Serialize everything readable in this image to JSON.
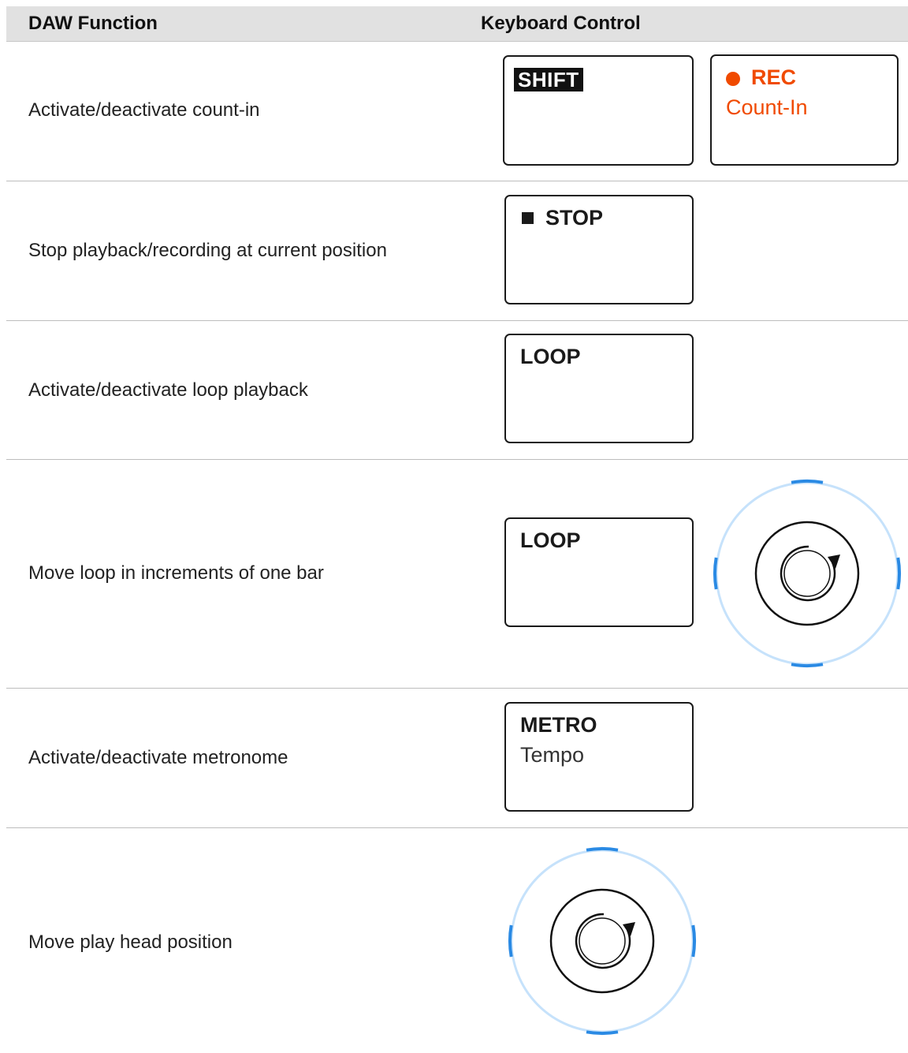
{
  "table": {
    "headers": {
      "function": "DAW Function",
      "control": "Keyboard Control"
    },
    "rows": [
      {
        "function": "Activate/deactivate count-in",
        "keys": [
          {
            "label": "SHIFT",
            "sub": ""
          },
          {
            "label": "REC",
            "sub": "Count-In",
            "indicator": "record-dot-icon"
          }
        ]
      },
      {
        "function": "Stop playback/recording at current position",
        "keys": [
          {
            "label": "STOP",
            "sub": "",
            "indicator": "stop-square-icon"
          }
        ]
      },
      {
        "function": "Activate/deactivate loop playback",
        "keys": [
          {
            "label": "LOOP",
            "sub": ""
          }
        ]
      },
      {
        "function": "Move loop in increments of one bar",
        "keys": [
          {
            "label": "LOOP",
            "sub": ""
          }
        ],
        "knob": "four-d-encoder-rotate-icon"
      },
      {
        "function": "Activate/deactivate metronome",
        "keys": [
          {
            "label": "METRO",
            "sub": "Tempo"
          }
        ]
      },
      {
        "function": "Move play head position",
        "keys": [],
        "knob": "four-d-encoder-rotate-icon"
      }
    ]
  },
  "colors": {
    "header_bg": "#e1e1e1",
    "rec_accent": "#f04a00",
    "knob_ring": "#c6e2fb",
    "knob_marker": "#2a8ae4"
  }
}
